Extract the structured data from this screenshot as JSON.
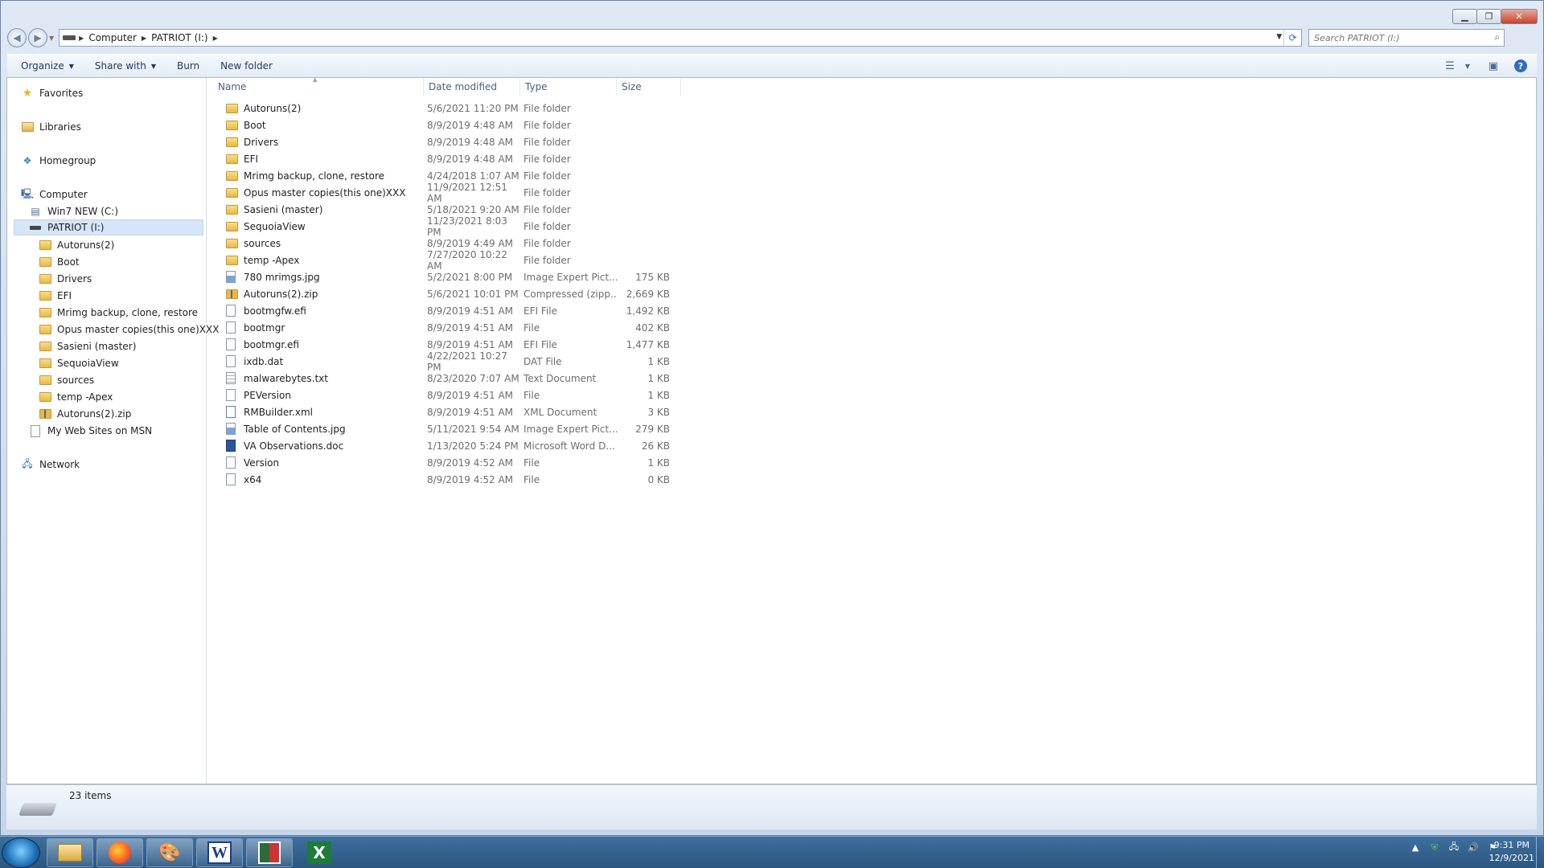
{
  "address": {
    "segments": [
      "Computer",
      "PATRIOT (I:)"
    ]
  },
  "search": {
    "placeholder": "Search PATRIOT (I:)"
  },
  "toolbar": {
    "organize": "Organize",
    "share_with": "Share with",
    "burn": "Burn",
    "new_folder": "New folder"
  },
  "nav": {
    "favorites": "Favorites",
    "libraries": "Libraries",
    "homegroup": "Homegroup",
    "computer": "Computer",
    "drive_c": "Win7 NEW (C:)",
    "drive_i": "PATRIOT (I:)",
    "subfolders": [
      "Autoruns(2)",
      "Boot",
      "Drivers",
      "EFI",
      "Mrimg backup, clone, restore",
      "Opus master copies(this one)XXX",
      "Sasieni (master)",
      "SequoiaView",
      "sources",
      "temp -Apex",
      "Autoruns(2).zip"
    ],
    "msn": "My Web Sites on MSN",
    "network": "Network"
  },
  "columns": {
    "name": "Name",
    "date": "Date modified",
    "type": "Type",
    "size": "Size"
  },
  "files": [
    {
      "name": "Autoruns(2)",
      "date": "5/6/2021 11:20 PM",
      "type": "File folder",
      "size": "",
      "icon": "folder"
    },
    {
      "name": "Boot",
      "date": "8/9/2019 4:48 AM",
      "type": "File folder",
      "size": "",
      "icon": "folder"
    },
    {
      "name": "Drivers",
      "date": "8/9/2019 4:48 AM",
      "type": "File folder",
      "size": "",
      "icon": "folder"
    },
    {
      "name": "EFI",
      "date": "8/9/2019 4:48 AM",
      "type": "File folder",
      "size": "",
      "icon": "folder"
    },
    {
      "name": "Mrimg backup, clone, restore",
      "date": "4/24/2018 1:07 AM",
      "type": "File folder",
      "size": "",
      "icon": "folder"
    },
    {
      "name": "Opus master copies(this one)XXX",
      "date": "11/9/2021 12:51 AM",
      "type": "File folder",
      "size": "",
      "icon": "folder"
    },
    {
      "name": "Sasieni (master)",
      "date": "5/18/2021 9:20 AM",
      "type": "File folder",
      "size": "",
      "icon": "folder"
    },
    {
      "name": "SequoiaView",
      "date": "11/23/2021 8:03 PM",
      "type": "File folder",
      "size": "",
      "icon": "folder"
    },
    {
      "name": "sources",
      "date": "8/9/2019 4:49 AM",
      "type": "File folder",
      "size": "",
      "icon": "folder"
    },
    {
      "name": "temp -Apex",
      "date": "7/27/2020 10:22 AM",
      "type": "File folder",
      "size": "",
      "icon": "folder"
    },
    {
      "name": "780 mrimgs.jpg",
      "date": "5/2/2021 8:00 PM",
      "type": "Image Expert Pict...",
      "size": "175 KB",
      "icon": "image"
    },
    {
      "name": "Autoruns(2).zip",
      "date": "5/6/2021 10:01 PM",
      "type": "Compressed (zipp...",
      "size": "2,669 KB",
      "icon": "zip"
    },
    {
      "name": "bootmgfw.efi",
      "date": "8/9/2019 4:51 AM",
      "type": "EFI File",
      "size": "1,492 KB",
      "icon": "file"
    },
    {
      "name": "bootmgr",
      "date": "8/9/2019 4:51 AM",
      "type": "File",
      "size": "402 KB",
      "icon": "file"
    },
    {
      "name": "bootmgr.efi",
      "date": "8/9/2019 4:51 AM",
      "type": "EFI File",
      "size": "1,477 KB",
      "icon": "file"
    },
    {
      "name": "ixdb.dat",
      "date": "4/22/2021 10:27 PM",
      "type": "DAT File",
      "size": "1 KB",
      "icon": "file"
    },
    {
      "name": "malwarebytes.txt",
      "date": "8/23/2020 7:07 AM",
      "type": "Text Document",
      "size": "1 KB",
      "icon": "text"
    },
    {
      "name": "PEVersion",
      "date": "8/9/2019 4:51 AM",
      "type": "File",
      "size": "1 KB",
      "icon": "file"
    },
    {
      "name": "RMBuilder.xml",
      "date": "8/9/2019 4:51 AM",
      "type": "XML Document",
      "size": "3 KB",
      "icon": "xml"
    },
    {
      "name": "Table of Contents.jpg",
      "date": "5/11/2021 9:54 AM",
      "type": "Image Expert Pict...",
      "size": "279 KB",
      "icon": "image"
    },
    {
      "name": "VA Observations.doc",
      "date": "1/13/2020 5:24 PM",
      "type": "Microsoft Word D...",
      "size": "26 KB",
      "icon": "word"
    },
    {
      "name": "Version",
      "date": "8/9/2019 4:52 AM",
      "type": "File",
      "size": "1 KB",
      "icon": "file"
    },
    {
      "name": "x64",
      "date": "8/9/2019 4:52 AM",
      "type": "File",
      "size": "0 KB",
      "icon": "file"
    }
  ],
  "status": {
    "count": "23 items"
  },
  "clock": {
    "time": "9:31 PM",
    "date": "12/9/2021"
  },
  "taskbar": {
    "word_letter": "W",
    "excel_letter": "X"
  }
}
